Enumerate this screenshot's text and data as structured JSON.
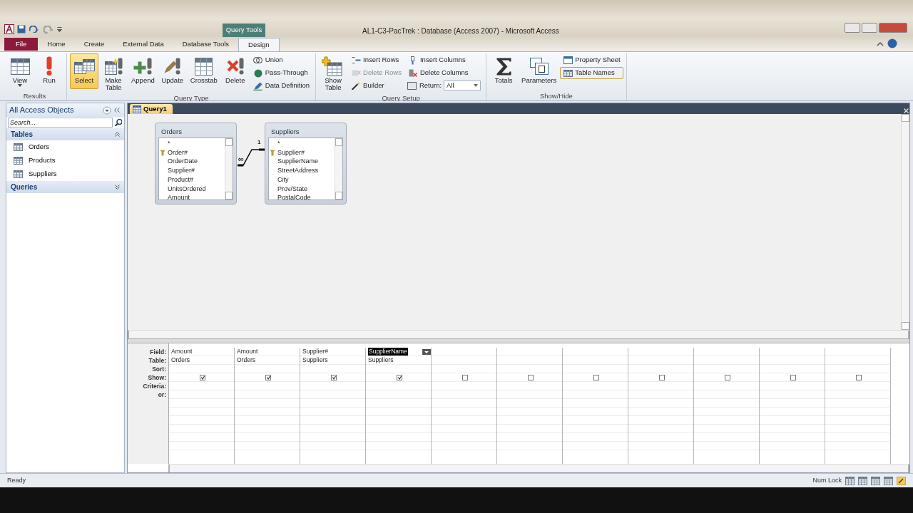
{
  "title_bar": {
    "title": "AL1-C3-PacTrek : Database (Access 2007)  -  Microsoft Access",
    "contextual_tab": "Query Tools"
  },
  "ribbon_tabs": [
    {
      "label": "File",
      "kind": "file",
      "selected": false
    },
    {
      "label": "Home",
      "kind": "tab",
      "selected": false
    },
    {
      "label": "Create",
      "kind": "tab",
      "selected": false
    },
    {
      "label": "External Data",
      "kind": "tab",
      "selected": false
    },
    {
      "label": "Database Tools",
      "kind": "tab",
      "selected": false
    },
    {
      "label": "Design",
      "kind": "tab",
      "selected": true
    }
  ],
  "ribbon_groups": [
    {
      "label": "Results",
      "items": [
        {
          "label": "View",
          "kind": "large-menu",
          "active": false,
          "disabled": false
        },
        {
          "label": "Run",
          "kind": "large",
          "active": false,
          "disabled": false
        }
      ]
    },
    {
      "label": "Query Type",
      "items": [
        {
          "label": "Select",
          "kind": "large",
          "active": true,
          "disabled": false
        },
        {
          "label": "Make Table",
          "kind": "large",
          "active": false,
          "disabled": false
        },
        {
          "label": "Append",
          "kind": "large",
          "active": false,
          "disabled": false
        },
        {
          "label": "Update",
          "kind": "large",
          "active": false,
          "disabled": false
        },
        {
          "label": "Crosstab",
          "kind": "large",
          "active": false,
          "disabled": false
        },
        {
          "label": "Delete",
          "kind": "large",
          "active": false,
          "disabled": false
        },
        {
          "label": "Union",
          "kind": "small",
          "active": false,
          "disabled": false
        },
        {
          "label": "Pass-Through",
          "kind": "small",
          "active": false,
          "disabled": false
        },
        {
          "label": "Data Definition",
          "kind": "small",
          "active": false,
          "disabled": false
        }
      ]
    },
    {
      "label": "Query Setup",
      "items": [
        {
          "label": "Show Table",
          "kind": "large",
          "active": false,
          "disabled": false
        },
        {
          "label": "Insert Rows",
          "kind": "small",
          "active": false,
          "disabled": false
        },
        {
          "label": "Delete Rows",
          "kind": "small",
          "active": false,
          "disabled": true
        },
        {
          "label": "Builder",
          "kind": "small",
          "active": false,
          "disabled": false
        },
        {
          "label": "Insert Columns",
          "kind": "small",
          "active": false,
          "disabled": false
        },
        {
          "label": "Delete Columns",
          "kind": "small",
          "active": false,
          "disabled": false
        },
        {
          "label": "Return:",
          "kind": "select",
          "value": "All",
          "active": false,
          "disabled": false
        }
      ]
    },
    {
      "label": "Show/Hide",
      "items": [
        {
          "label": "Totals",
          "kind": "large",
          "active": false,
          "disabled": false
        },
        {
          "label": "Parameters",
          "kind": "large",
          "active": false,
          "disabled": false
        },
        {
          "label": "Property Sheet",
          "kind": "small",
          "active": false,
          "disabled": false
        },
        {
          "label": "Table Names",
          "kind": "small",
          "active": true,
          "disabled": false
        }
      ]
    }
  ],
  "nav_pane": {
    "title": "All Access Objects",
    "search": {
      "placeholder": "Search..."
    },
    "groups": [
      {
        "label": "Tables",
        "expanded": true,
        "items": [
          "Orders",
          "Products",
          "Suppliers"
        ]
      },
      {
        "label": "Queries",
        "expanded": false
      }
    ]
  },
  "document_tab": {
    "label": "Query1"
  },
  "table_boxes": [
    {
      "name": "Orders",
      "fields": [
        {
          "name": "*",
          "key": false
        },
        {
          "name": "Order#",
          "key": true
        },
        {
          "name": "OrderDate",
          "key": false
        },
        {
          "name": "Supplier#",
          "key": false
        },
        {
          "name": "Product#",
          "key": false
        },
        {
          "name": "UnitsOrdered",
          "key": false
        },
        {
          "name": "Amount",
          "key": false
        }
      ]
    },
    {
      "name": "Suppliers",
      "fields": [
        {
          "name": "*",
          "key": false
        },
        {
          "name": "Supplier#",
          "key": true
        },
        {
          "name": "SupplierName",
          "key": false
        },
        {
          "name": "StreetAddress",
          "key": false
        },
        {
          "name": "City",
          "key": false
        },
        {
          "name": "Prov/State",
          "key": false
        },
        {
          "name": "PostalCode",
          "key": false
        }
      ]
    }
  ],
  "relationship": {
    "many_label": "∞",
    "one_label": "1"
  },
  "design_grid": {
    "row_labels": [
      "Field:",
      "Table:",
      "Sort:",
      "Show:",
      "Criteria:",
      "or:"
    ],
    "columns": [
      {
        "field": "Amount",
        "table": "Orders",
        "show": true,
        "selected": false
      },
      {
        "field": "Amount",
        "table": "Orders",
        "show": true,
        "selected": false
      },
      {
        "field": "Supplier#",
        "table": "Suppliers",
        "show": true,
        "selected": false
      },
      {
        "field": "SupplierName",
        "table": "Suppliers",
        "show": true,
        "selected": true
      },
      {
        "show": false,
        "selected": false
      },
      {
        "show": false,
        "selected": false
      },
      {
        "show": false,
        "selected": false
      },
      {
        "show": false,
        "selected": false
      },
      {
        "show": false,
        "selected": false
      },
      {
        "show": false,
        "selected": false
      },
      {
        "show": false,
        "selected": false
      }
    ]
  },
  "status_bar": {
    "text": "Ready",
    "indicator": "Num Lock"
  }
}
